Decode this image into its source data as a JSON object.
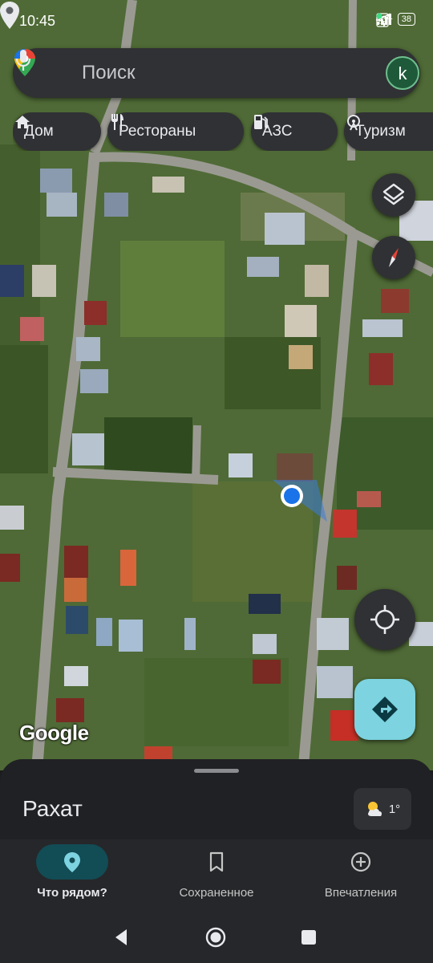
{
  "status_bar": {
    "time": "10:45",
    "network": "4G+",
    "battery": "38"
  },
  "search": {
    "placeholder": "Поиск",
    "avatar_letter": "k",
    "icons": [
      "google-maps-pin-icon",
      "microphone-icon"
    ]
  },
  "chips": [
    {
      "label": "Дом",
      "icon": "home-icon"
    },
    {
      "label": "Рестораны",
      "icon": "restaurant-icon"
    },
    {
      "label": "АЗС",
      "icon": "gas-station-icon"
    },
    {
      "label": "Туризм",
      "icon": "attraction-icon"
    }
  ],
  "map": {
    "attribution": "Google",
    "type": "satellite",
    "controls": [
      "layers-icon",
      "compass-icon",
      "my-location-icon",
      "directions-icon"
    ]
  },
  "sheet": {
    "place_name": "Рахат",
    "weather_temp": "1°",
    "weather_icon": "partly-cloudy-icon"
  },
  "bottom_nav": {
    "items": [
      {
        "label": "Что рядом?",
        "icon": "location-pin-icon",
        "active": true
      },
      {
        "label": "Сохраненное",
        "icon": "bookmark-icon",
        "active": false
      },
      {
        "label": "Впечатления",
        "icon": "add-circle-icon",
        "active": false
      }
    ]
  },
  "colors": {
    "surface": "#303134",
    "sheet": "#202124",
    "accent_active": "#124c55",
    "directions_button": "#7dd3e0",
    "location_dot": "#1a73e8"
  }
}
